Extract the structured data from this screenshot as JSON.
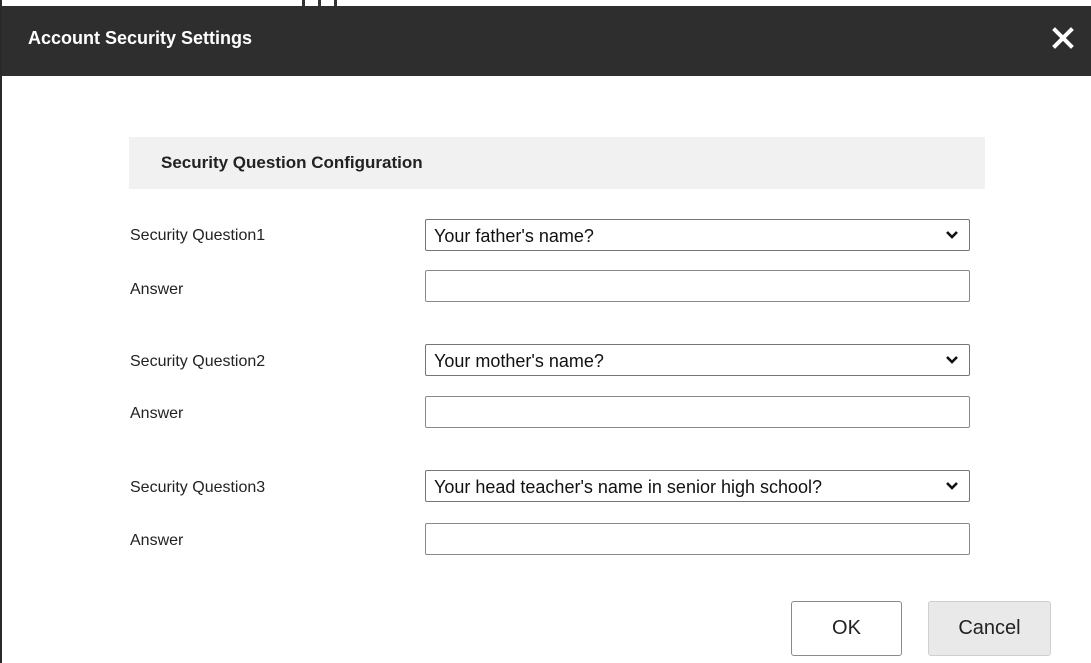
{
  "dialog": {
    "title": "Account Security Settings",
    "close_icon": "close-icon"
  },
  "section": {
    "title": "Security Question Configuration"
  },
  "questions": [
    {
      "label": "Security Question1",
      "selected": "Your father's name?",
      "answer_label": "Answer",
      "answer_value": ""
    },
    {
      "label": "Security Question2",
      "selected": "Your mother's name?",
      "answer_label": "Answer",
      "answer_value": ""
    },
    {
      "label": "Security Question3",
      "selected": "Your head teacher's name in senior high school?",
      "answer_label": "Answer",
      "answer_value": ""
    }
  ],
  "buttons": {
    "ok_label": "OK",
    "cancel_label": "Cancel"
  },
  "colors": {
    "titlebar": "#2e2e2e",
    "section_bg": "#f1f1f1",
    "cancel_bg": "#e9e9e9"
  }
}
